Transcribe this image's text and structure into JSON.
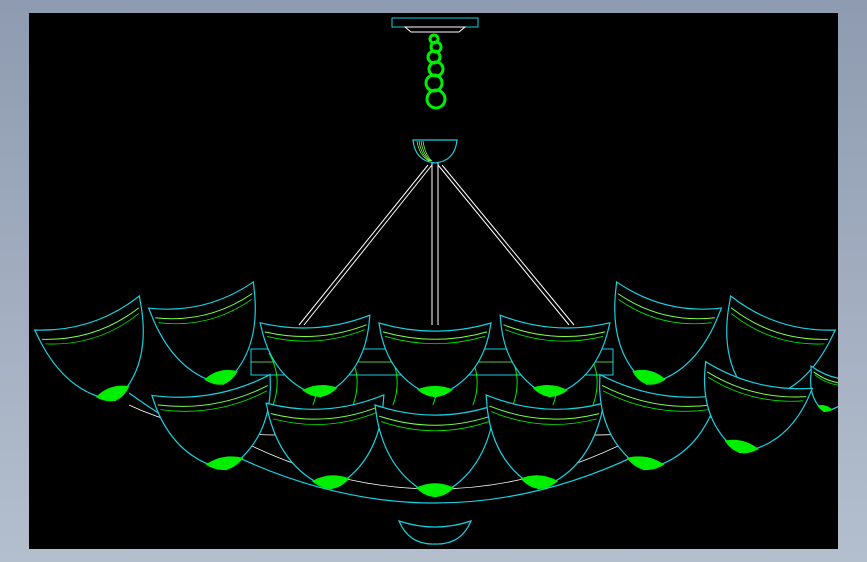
{
  "drawing": {
    "subject": "chandelier-elevation",
    "background": "#000000",
    "window_background": "#9aa6b8",
    "colors": {
      "outline": "#19d1e0",
      "fill": "#00ee00",
      "detail": "#7cff4a",
      "structure": "#ffffff"
    },
    "chain_links": 6,
    "arms": 2,
    "upper_shades": 8,
    "lower_shades": 6
  }
}
